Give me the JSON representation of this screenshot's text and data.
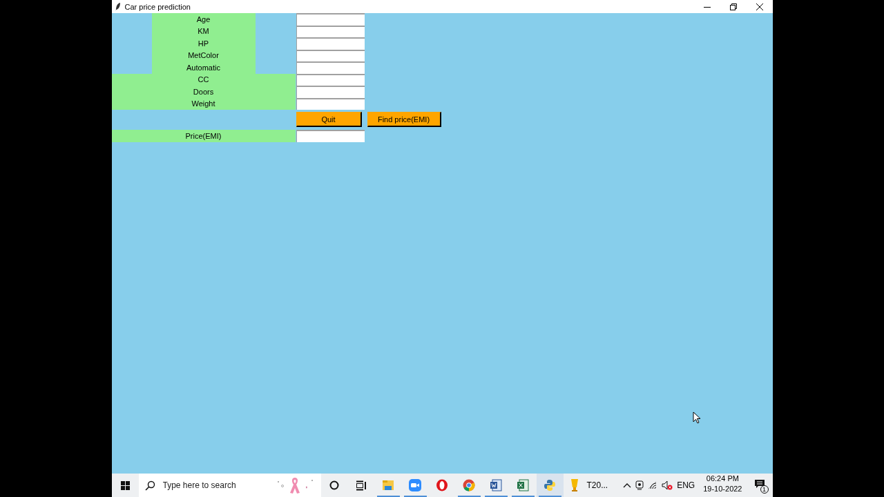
{
  "window": {
    "title": "Car price prediction"
  },
  "fields": [
    {
      "label": "Age",
      "wide": false
    },
    {
      "label": "KM",
      "wide": false
    },
    {
      "label": "HP",
      "wide": false
    },
    {
      "label": "MetColor",
      "wide": false
    },
    {
      "label": "Automatic",
      "wide": false
    },
    {
      "label": "CC",
      "wide": true
    },
    {
      "label": "Doors",
      "wide": true
    },
    {
      "label": "Weight",
      "wide": true
    }
  ],
  "buttons": [
    {
      "label": "Quit"
    },
    {
      "label": "Find price(EMI)"
    }
  ],
  "result": {
    "label": "Price(EMI)",
    "wide": true
  },
  "taskbar": {
    "search": {
      "placeholder": "Type here to search"
    },
    "apps": [
      {
        "kind": "explorer",
        "running": true,
        "selected": false
      },
      {
        "kind": "zoom",
        "running": true,
        "selected": false
      },
      {
        "kind": "opera",
        "running": false,
        "selected": false
      },
      {
        "kind": "chrome",
        "running": true,
        "selected": false
      },
      {
        "kind": "word",
        "running": true,
        "selected": false
      },
      {
        "kind": "excel",
        "running": true,
        "selected": false
      },
      {
        "kind": "python",
        "running": true,
        "selected": true
      },
      {
        "kind": "trophy",
        "label": "T20...",
        "running": false,
        "selected": false
      }
    ],
    "language": "ENG",
    "time": "06:24 PM",
    "date": "19-10-2022",
    "notifications": "1"
  }
}
